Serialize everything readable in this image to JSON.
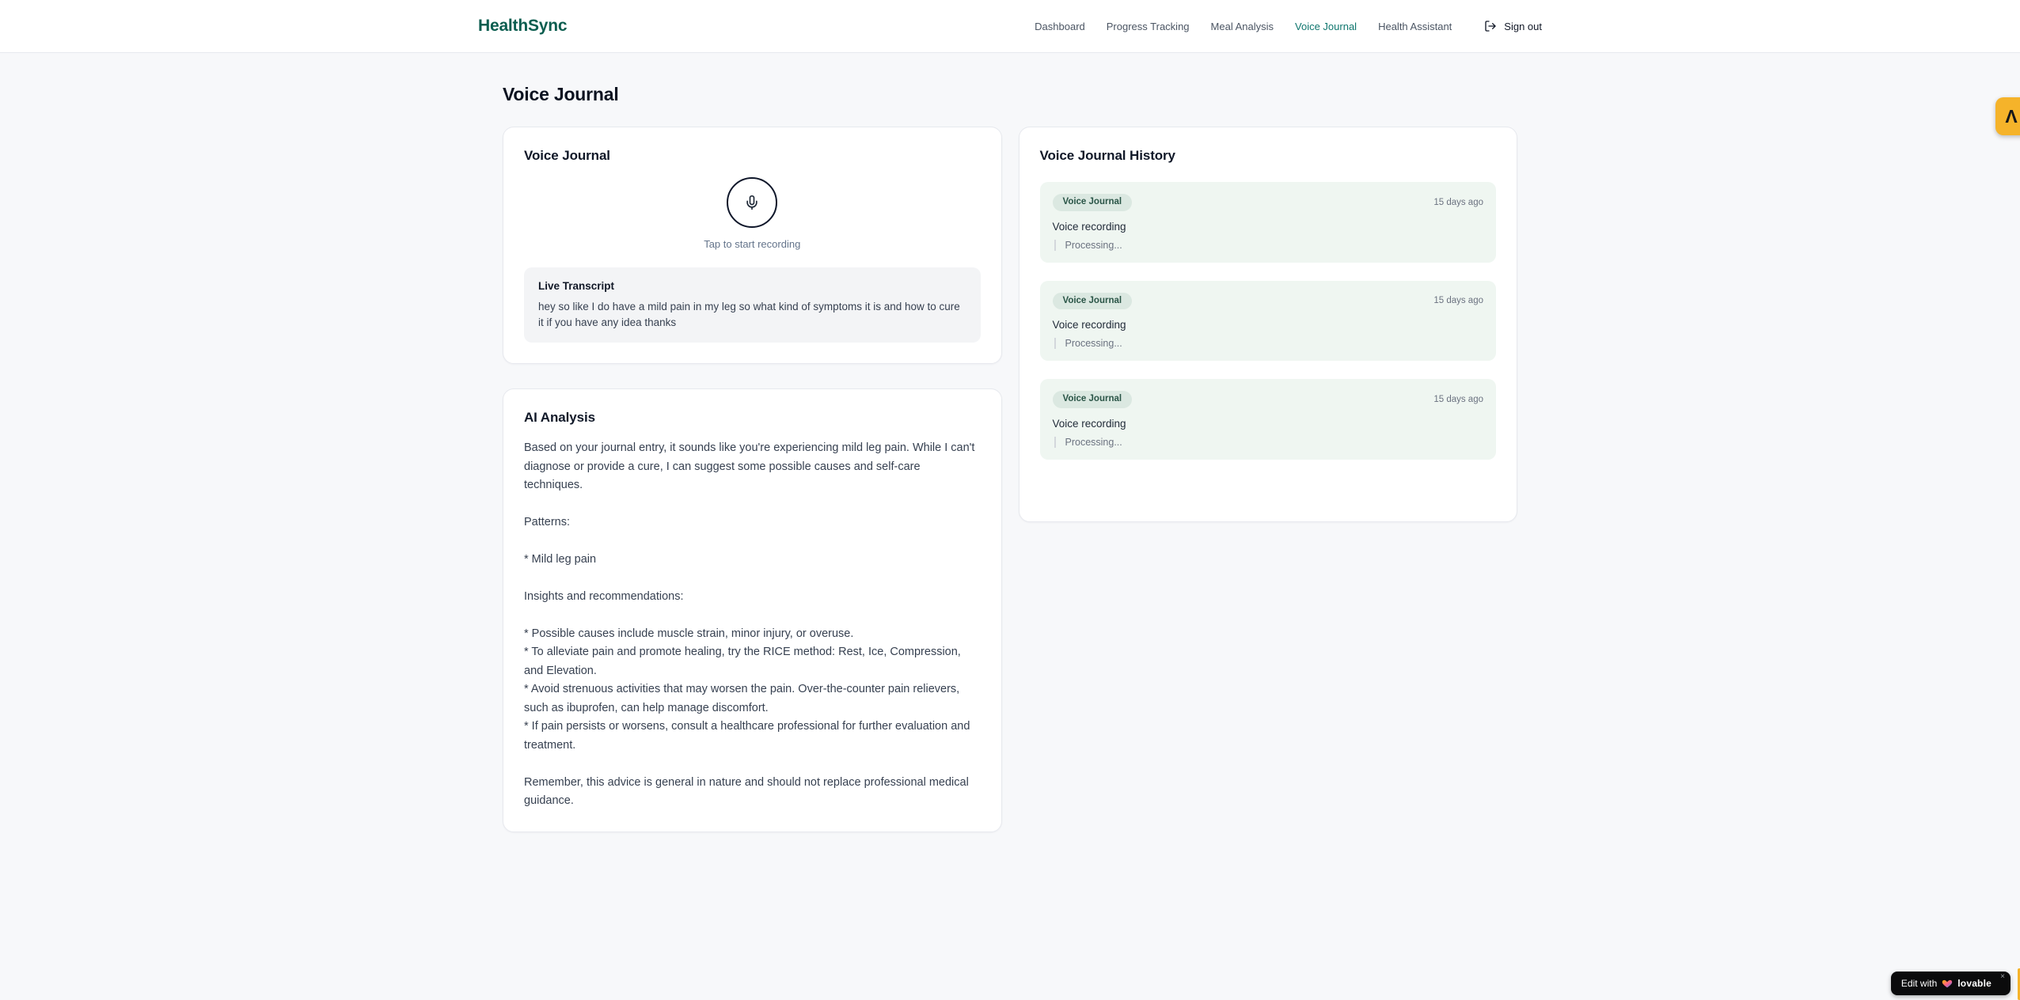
{
  "brand": {
    "name": "HealthSync"
  },
  "nav": {
    "items": [
      {
        "label": "Dashboard",
        "active": false
      },
      {
        "label": "Progress Tracking",
        "active": false
      },
      {
        "label": "Meal Analysis",
        "active": false
      },
      {
        "label": "Voice Journal",
        "active": true
      },
      {
        "label": "Health Assistant",
        "active": false
      }
    ],
    "sign_out_label": "Sign out",
    "sign_out_icon": "logout-icon"
  },
  "page": {
    "title": "Voice Journal"
  },
  "recorder_card": {
    "title": "Voice Journal",
    "mic_icon": "microphone-icon",
    "tap_hint": "Tap to start recording",
    "transcript_title": "Live Transcript",
    "transcript_text": "hey so like I do have a mild pain in my leg so what kind of symptoms it is and how to cure it if you have any idea thanks"
  },
  "analysis_card": {
    "title": "AI Analysis",
    "body": "Based on your journal entry, it sounds like you're experiencing mild leg pain. While I can't diagnose or provide a cure, I can suggest some possible causes and self-care techniques.\n\nPatterns:\n\n* Mild leg pain\n\nInsights and recommendations:\n\n* Possible causes include muscle strain, minor injury, or overuse.\n* To alleviate pain and promote healing, try the RICE method: Rest, Ice, Compression, and Elevation.\n* Avoid strenuous activities that may worsen the pain. Over-the-counter pain relievers, such as ibuprofen, can help manage discomfort.\n* If pain persists or worsens, consult a healthcare professional for further evaluation and treatment.\n\nRemember, this advice is general in nature and should not replace professional medical guidance."
  },
  "history_card": {
    "title": "Voice Journal History",
    "entries": [
      {
        "badge": "Voice Journal",
        "timestamp": "15 days ago",
        "summary": "Voice recording",
        "status": "Processing..."
      },
      {
        "badge": "Voice Journal",
        "timestamp": "15 days ago",
        "summary": "Voice recording",
        "status": "Processing..."
      },
      {
        "badge": "Voice Journal",
        "timestamp": "15 days ago",
        "summary": "Voice recording",
        "status": "Processing..."
      }
    ]
  },
  "widgets": {
    "lovable_badge": {
      "prefix": "Edit with",
      "brand": "lovable",
      "close": "×",
      "heart_icon": "heart-icon"
    },
    "side_tab": {
      "glyph": "Λ",
      "icon": "brand-tab-icon"
    }
  },
  "colors": {
    "brand_green": "#0b5d4f",
    "nav_active": "#0f766e",
    "page_bg": "#f7f8fa",
    "entry_bg": "#eff6f1",
    "badge_bg": "#dbe8e1",
    "badge_text": "#2a5547",
    "amber": "#f5b32a"
  }
}
